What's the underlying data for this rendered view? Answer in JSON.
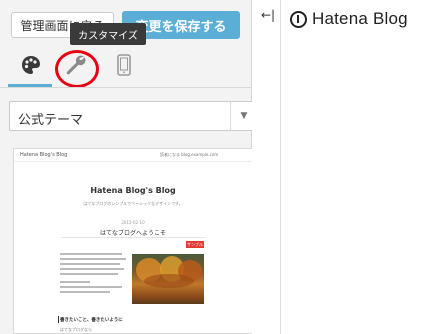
{
  "toolbar": {
    "back_label": "管理画面に戻る",
    "save_label": "変更を保存する"
  },
  "tooltip": "カスタマイズ",
  "theme_select": {
    "selected": "公式テーマ"
  },
  "collapse_icon": "collapse-icon",
  "brand": {
    "name": "Hatena Blog"
  },
  "preview": {
    "topbar_title": "Hatena Blog's Blog",
    "topbar_right": "読者になる  blog.example.com",
    "blog_title": "Hatena Blog's Blog",
    "blog_subtitle": "はてなブログのシンプルでベーシックなデザインです。",
    "date": "2015-02-10",
    "post_title": "はてなブログへようこそ",
    "sample_badge": "サンプル",
    "heading": "書きたいこと、書きたいように",
    "tail": "はてなブログなら"
  },
  "colors": {
    "accent": "#5bafd6",
    "highlight_circle": "#e60012",
    "tooltip_bg": "#3a3a3a"
  }
}
